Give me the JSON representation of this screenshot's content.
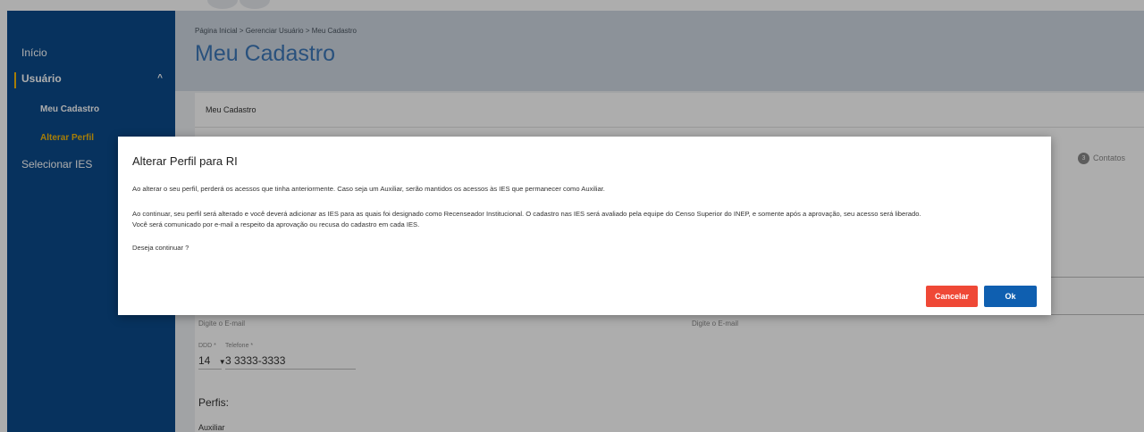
{
  "sidebar": {
    "items": [
      {
        "label": "Início"
      },
      {
        "label": "Usuário",
        "chevron": "^"
      },
      {
        "label": "Meu Cadastro"
      },
      {
        "label": "Alterar Perfil"
      },
      {
        "label": "Selecionar IES"
      }
    ]
  },
  "header": {
    "breadcrumb": "Página Inicial > Gerenciar Usuário > Meu Cadastro",
    "title": "Meu Cadastro"
  },
  "card": {
    "title": "Meu Cadastro",
    "step_number": "3",
    "step_label": "Contatos",
    "email_hint_left": "Digite o E-mail",
    "email_hint_right": "Digite o E-mail",
    "ddd_label": "DDD *",
    "phone_label": "Telefone *",
    "ddd_value": "14",
    "phone_value": "3 3333-3333",
    "profiles_title": "Perfis:",
    "profile_value": "Auxiliar"
  },
  "modal": {
    "title": "Alterar Perfil para RI",
    "p1": "Ao alterar o seu perfil, perderá os acessos que tinha anteriormente. Caso seja um Auxiliar, serão mantidos os acessos às IES que permanecer como Auxiliar.",
    "p2a": "Ao continuar, seu perfil será alterado e você deverá adicionar as IES para as quais foi designado como Recenseador Institucional. O cadastro nas IES será avaliado pela equipe do Censo Superior do INEP, e somente após a aprovação, seu acesso será liberado.",
    "p2b": "Você será comunicado por e-mail a respeito da aprovação ou recusa do cadastro em cada IES.",
    "p3": "Deseja continuar ?",
    "cancel_label": "Cancelar",
    "ok_label": "Ok"
  },
  "colors": {
    "sidebar_bg": "#0b4a8b",
    "accent_yellow": "#f5b90b",
    "title_blue": "#3d78b8",
    "cancel_red": "#ef4836",
    "ok_blue": "#0f5fb0"
  }
}
